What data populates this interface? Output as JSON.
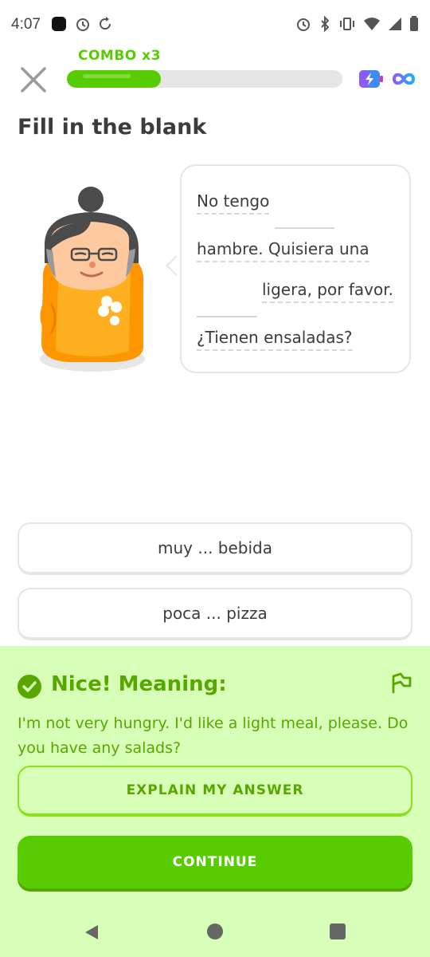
{
  "status_bar": {
    "time": "4:07",
    "left_icons": [
      "app-icon",
      "alarm-icon",
      "sync-icon"
    ],
    "right_icons": [
      "alarm-icon",
      "bluetooth-icon",
      "vibrate-icon",
      "wifi-icon",
      "signal-icon",
      "battery-icon"
    ]
  },
  "header": {
    "combo": "COMBO x3",
    "progress": 0.34,
    "accent_color": "#58cc02"
  },
  "lesson": {
    "title": "Fill in the blank",
    "sentence": {
      "line1": "No tengo",
      "line2": "hambre. Quisiera una",
      "line3": "ligera, por favor.",
      "line4": "¿Tienen ensaladas?"
    }
  },
  "options": [
    {
      "label": "muy ... bebida"
    },
    {
      "label": "poca ... pizza"
    }
  ],
  "feedback": {
    "title": "Nice! Meaning:",
    "text": "I'm not very hungry. I'd like a light meal, please. Do you have any salads?",
    "explain_label": "EXPLAIN MY ANSWER",
    "continue_label": "CONTINUE",
    "bg_color": "#d7ffb8",
    "text_color": "#58a700"
  }
}
